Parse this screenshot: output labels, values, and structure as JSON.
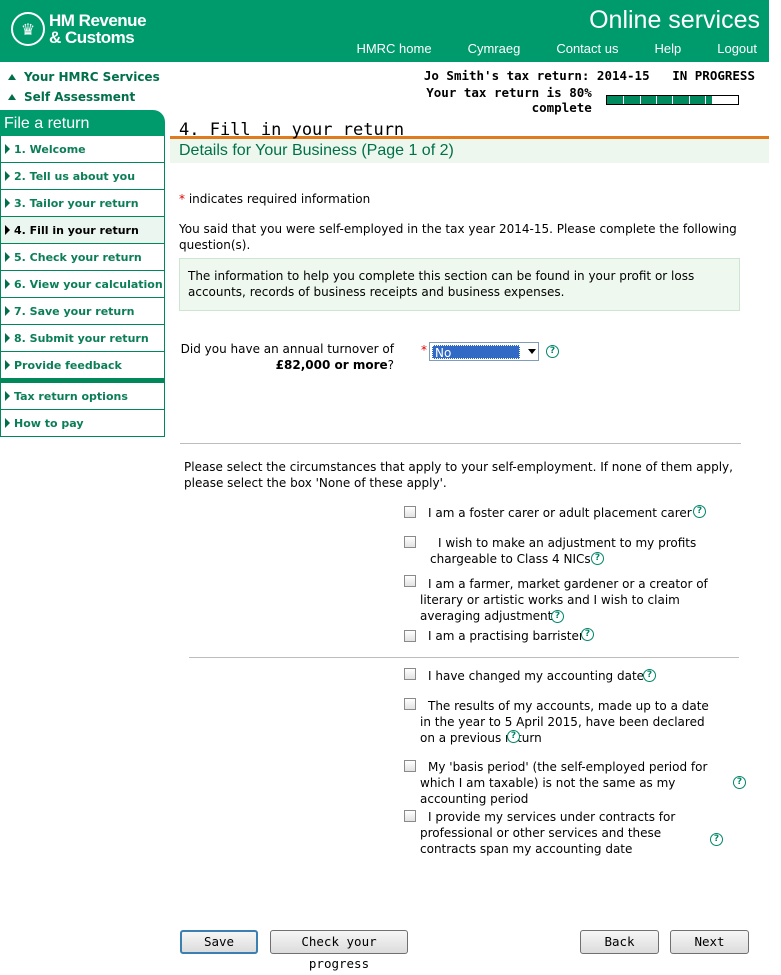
{
  "header": {
    "logo_line1": "HM Revenue",
    "logo_line2": "& Customs",
    "service_title": "Online services",
    "nav": [
      "HMRC home",
      "Cymraeg",
      "Contact us",
      "Help",
      "Logout"
    ]
  },
  "side_links": [
    "Your HMRC Services",
    "Self Assessment"
  ],
  "status": {
    "return_title": "Jo Smith's tax return: 2014-15",
    "state": "IN PROGRESS",
    "complete_text": "Your tax return is 80% complete",
    "progress_fraction": 0.8
  },
  "sidebar": {
    "heading": "File a return",
    "steps": [
      "1. Welcome",
      "2. Tell us about you",
      "3. Tailor your return",
      "4. Fill in your return",
      "5. Check your return",
      "6. View your calculation",
      "7. Save your return",
      "8. Submit your return",
      "Provide feedback"
    ],
    "extra": [
      "Tax return options",
      "How to pay"
    ]
  },
  "main": {
    "title": "4. Fill in your return",
    "subtitle": "Details for Your Business (Page 1 of 2)",
    "required_star": "*",
    "required_note": "indicates required information",
    "intro": "You said that you were self-employed in the tax year 2014-15. Please complete the following question(s).",
    "info": "The information to help you complete this section can be found in your profit or loss accounts, records of business receipts and business expenses.",
    "turnover_q1": "Did you have an annual turnover of",
    "turnover_q2": "£82,000 or more",
    "turnover_q3": "?",
    "turnover_value": "No",
    "circumstances_intro": "Please select the circumstances that apply to your self-employment.  If none of them apply, please select the box 'None of these apply'.",
    "options_group1": [
      "I am a foster carer or adult placement carer",
      "I wish to make an adjustment to my profits chargeable to Class 4 NICs",
      "I am a farmer, market gardener or a creator of literary or artistic works and I wish to claim averaging adjustment",
      "I am a practising barrister"
    ],
    "options_group2": [
      "I have changed my accounting date",
      "The results of my accounts, made up to a date in the year to 5 April 2015, have been declared on a previous return",
      "My 'basis period' (the self-employed period for which I am taxable) is not the same as my accounting period",
      "I provide my services under contracts for professional or other services and these contracts span my accounting date"
    ]
  },
  "buttons": {
    "save": "Save",
    "check_progress": "Check your progress",
    "back": "Back",
    "next": "Next"
  },
  "help_glyph": "?",
  "colors": {
    "brand_green": "#009b6d",
    "accent_orange": "#e07b1d",
    "link_green": "#0b7e57"
  }
}
